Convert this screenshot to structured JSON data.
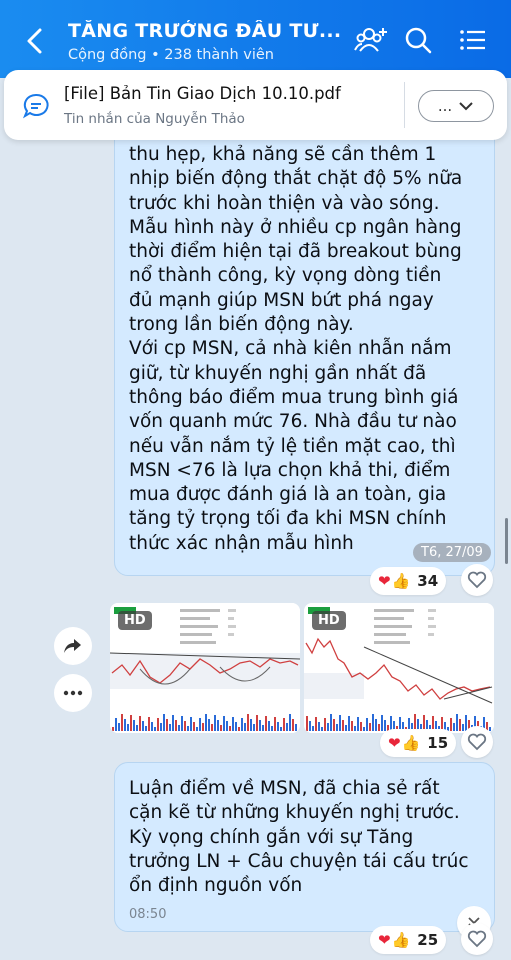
{
  "header": {
    "title": "TĂNG TRƯỞNG ĐẦU TƯ...",
    "subtitle": "Cộng đồng • 238 thành viên",
    "icons": [
      "back-arrow-icon",
      "add-member-icon",
      "search-icon",
      "menu-list-icon"
    ]
  },
  "pinned": {
    "title": "[File] Bản Tin Giao Dịch 10.10.pdf",
    "sub": "Tin nhắn của Nguyễn Thảo",
    "more": "..."
  },
  "message1": {
    "lines": [
      "thu hẹp, khả năng sẽ cần thêm 1",
      "nhịp biến động thắt chặt độ 5% nữa",
      "trước khi hoàn thiện và vào sóng.",
      "Mẫu hình này ở nhiều cp ngân hàng",
      "thời điểm hiện tại đã breakout bùng",
      "nổ thành công, kỳ vọng dòng tiền",
      "đủ mạnh giúp MSN bứt phá ngay",
      "trong lần biến động này.",
      "Với cp MSN, cả nhà kiên nhẫn nắm",
      "giữ, từ khuyến nghị gần nhất đã",
      "thông báo điểm mua trung bình giá",
      "vốn quanh mức 76. Nhà đầu tư nào",
      "nếu vẫn nắm tỷ lệ tiền mặt cao, thì",
      "MSN <76 là lựa chọn khả thi, điểm",
      "mua được đánh giá là an toàn, gia",
      "tăng tỷ trọng tối đa khi MSN chính",
      "thức xác nhận mẫu hình"
    ],
    "time": "T6, 27/09",
    "reaction_count": "34"
  },
  "images": {
    "badge": "HD",
    "reaction_count": "15"
  },
  "message2": {
    "lines": [
      "Luận điểm về MSN, đã chia sẻ rất",
      "cặn kẽ từ những khuyến nghị trước.",
      "Kỳ vọng chính gắn với sự Tăng",
      "trưởng LN + Câu chuyện tái cấu trúc",
      "ổn định nguồn vốn"
    ],
    "time": "08:50",
    "reaction_count": "25"
  },
  "colors": {
    "header": "#0a6be6",
    "bubble": "#d4eaff",
    "heart": "#e8263a",
    "like": "#f4b400"
  }
}
